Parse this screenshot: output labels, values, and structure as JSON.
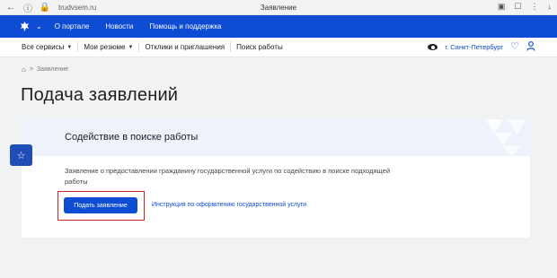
{
  "browser": {
    "url": "trudvsem.ru",
    "tab_title": "Заявление"
  },
  "topnav": {
    "links": [
      "О портале",
      "Новости",
      "Помощь и поддержка"
    ]
  },
  "subnav": {
    "items": [
      {
        "label": "Все сервисы",
        "dropdown": true
      },
      {
        "label": "Мои резюме",
        "dropdown": true
      },
      {
        "label": "Отклики и приглашения",
        "dropdown": false
      },
      {
        "label": "Поиск работы",
        "dropdown": false
      }
    ],
    "city": "г. Санкт-Петербург"
  },
  "breadcrumb": {
    "current": "Заявление"
  },
  "page": {
    "title": "Подача заявлений"
  },
  "card": {
    "title": "Содействие в поиске работы",
    "description": "Заявление о предоставлении гражданину государственной услуги по содействию в поиске подходящей работы",
    "apply_label": "Подать заявление",
    "instruction_label": "Инструкция по оформлению государственной услуги"
  },
  "colors": {
    "brand_blue": "#0d4cd3",
    "highlight_red": "#c8232c"
  }
}
